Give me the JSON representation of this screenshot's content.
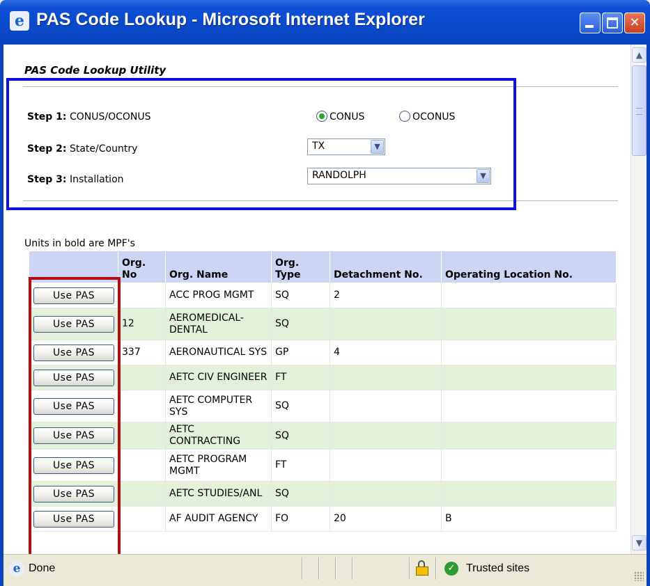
{
  "window": {
    "title": "PAS Code Lookup - Microsoft Internet Explorer"
  },
  "page": {
    "title": "PAS Code Lookup Utility",
    "step1": {
      "label": "Step 1:",
      "text": "CONUS/OCONUS",
      "options": [
        "CONUS",
        "OCONUS"
      ],
      "selected": "CONUS"
    },
    "step2": {
      "label": "Step 2:",
      "text": "State/Country",
      "value": "TX"
    },
    "step3": {
      "label": "Step 3:",
      "text": "Installation",
      "value": "RANDOLPH"
    },
    "units_note": "Units in bold are MPF's"
  },
  "table": {
    "headers": [
      "",
      "Org. No",
      "Org. Name",
      "Org. Type",
      "Detachment No.",
      "Operating Location No."
    ],
    "button_label": "Use PAS",
    "rows": [
      [
        "",
        "ACC PROG MGMT",
        "SQ",
        "2",
        ""
      ],
      [
        "12",
        "AEROMEDICAL-DENTAL",
        "SQ",
        "",
        ""
      ],
      [
        "337",
        "AERONAUTICAL SYS",
        "GP",
        "4",
        ""
      ],
      [
        "",
        "AETC CIV ENGINEER",
        "FT",
        "",
        ""
      ],
      [
        "",
        "AETC COMPUTER SYS",
        "SQ",
        "",
        ""
      ],
      [
        "",
        "AETC CONTRACTING",
        "SQ",
        "",
        ""
      ],
      [
        "",
        "AETC PROGRAM MGMT",
        "FT",
        "",
        ""
      ],
      [
        "",
        "AETC STUDIES/ANL",
        "SQ",
        "",
        ""
      ],
      [
        "",
        "AF AUDIT AGENCY",
        "FO",
        "20",
        "B"
      ]
    ]
  },
  "status": {
    "text": "Done",
    "zone": "Trusted sites"
  },
  "colors": {
    "highlight_steps": "#1010E0",
    "highlight_buttons": "#B01010",
    "header_bg": "#CCD6F4",
    "alt_row": "#E3F0DA"
  },
  "icons": {
    "title": "ie-icon",
    "status": "ie-icon",
    "security": "lock-icon",
    "zone": "check-icon"
  }
}
